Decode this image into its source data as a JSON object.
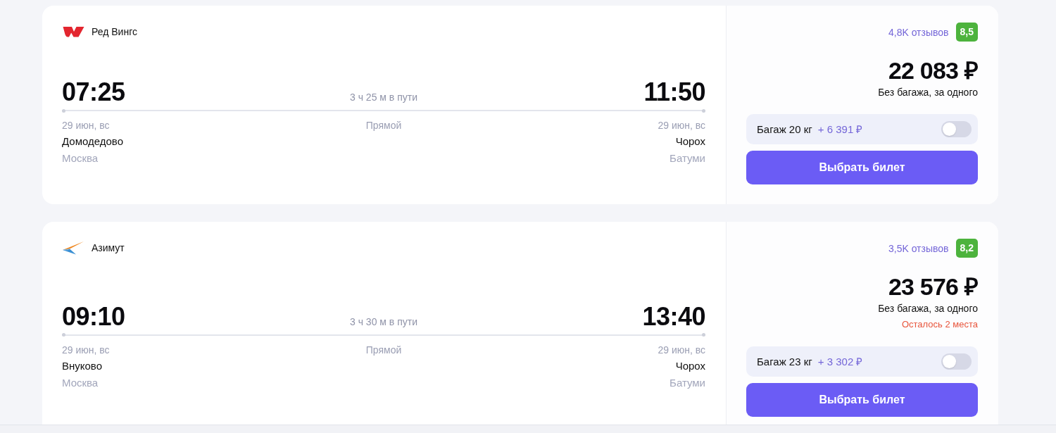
{
  "flights": [
    {
      "airline": {
        "name": "Ред Вингс",
        "kind": "wings"
      },
      "departure": {
        "time": "07:25",
        "date": "29 июн, вс",
        "airport": "Домодедово",
        "city": "Москва"
      },
      "duration": "3 ч 25 м в пути",
      "stops": "Прямой",
      "arrival": {
        "time": "11:50",
        "date": "29 июн, вс",
        "airport": "Чорох",
        "city": "Батуми"
      },
      "reviews": "4,8K отзывов",
      "rating": "8,5",
      "price": "22 083 ₽",
      "price_note": "Без багажа, за одного",
      "baggage": {
        "label": "Багаж 20 кг",
        "price": "+ 6 391 ₽",
        "on": false
      },
      "button": "Выбрать билет"
    },
    {
      "airline": {
        "name": "Азимут",
        "kind": "chevron"
      },
      "departure": {
        "time": "09:10",
        "date": "29 июн, вс",
        "airport": "Внуково",
        "city": "Москва"
      },
      "duration": "3 ч 30 м в пути",
      "stops": "Прямой",
      "arrival": {
        "time": "13:40",
        "date": "29 июн, вс",
        "airport": "Чорох",
        "city": "Батуми"
      },
      "reviews": "3,5K отзывов",
      "rating": "8,2",
      "price": "23 576 ₽",
      "price_note": "Без багажа, за одного",
      "seats_left": "Осталось 2 места",
      "baggage": {
        "label": "Багаж 23 кг",
        "price": "+ 3 302 ₽",
        "on": false
      },
      "button": "Выбрать билет"
    }
  ]
}
